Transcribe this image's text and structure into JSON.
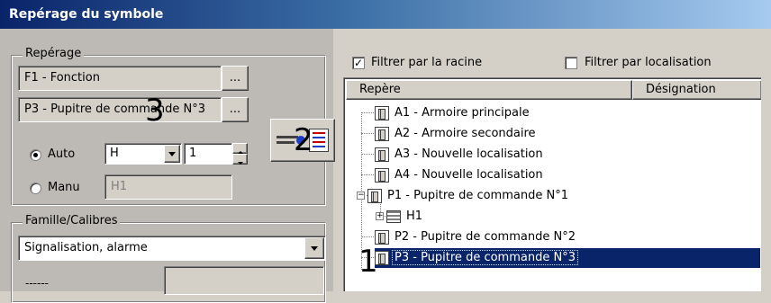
{
  "window": {
    "title": "Repérage du symbole"
  },
  "reperage": {
    "legend": "Repérage",
    "fonction_value": "F1 - Fonction",
    "localisation_value": "P3 - Pupitre de commande N°3",
    "browse_label": "...",
    "auto_label": "Auto",
    "manu_label": "Manu",
    "selected_mode": "Auto",
    "prefix_value": "H",
    "number_value": "1",
    "manual_value": "H1"
  },
  "famille": {
    "legend": "Famille/Calibres",
    "famille_value": "Signalisation, alarme",
    "calibre_value": "------"
  },
  "filters": {
    "racine_label": "Filtrer par la racine",
    "racine_checked": true,
    "localisation_label": "Filtrer par localisation",
    "localisation_checked": false
  },
  "tree": {
    "columns": [
      "Repère",
      "Désignation"
    ],
    "rows": [
      {
        "label": "A1 - Armoire principale",
        "level": 0,
        "icon": "location-node-icon"
      },
      {
        "label": "A2 - Armoire secondaire",
        "level": 0,
        "icon": "location-node-icon"
      },
      {
        "label": "A3 - Nouvelle localisation",
        "level": 0,
        "icon": "location-node-icon"
      },
      {
        "label": "A4 - Nouvelle localisation",
        "level": 0,
        "icon": "location-node-icon"
      },
      {
        "label": "P1 - Pupitre de commande N°1",
        "level": 0,
        "icon": "location-node-icon",
        "expanded": true
      },
      {
        "label": "H1",
        "level": 1,
        "icon": "device-icon",
        "collapsed": true
      },
      {
        "label": "P2 - Pupitre de commande N°2",
        "level": 0,
        "icon": "location-node-icon"
      },
      {
        "label": "P3 - Pupitre de commande N°3",
        "level": 0,
        "icon": "location-node-icon",
        "selected": true
      }
    ]
  },
  "annotations": {
    "marker_1": "1",
    "marker_2": "2",
    "marker_3": "3"
  },
  "colors": {
    "title_start": "#0a246a",
    "title_end": "#a6caf0",
    "selection": "#0a246a",
    "face": "#d4d0c8"
  }
}
